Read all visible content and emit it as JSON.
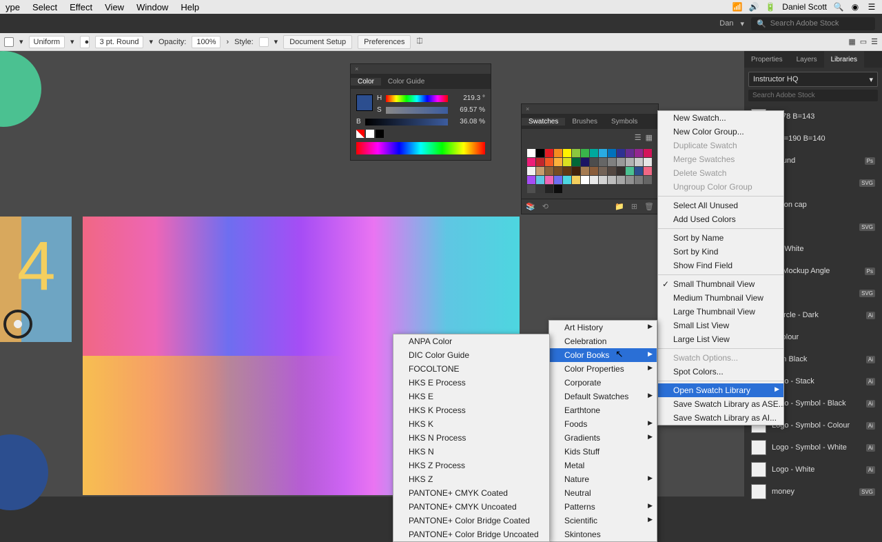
{
  "menubar": {
    "items": [
      "ype",
      "Select",
      "Effect",
      "View",
      "Window",
      "Help"
    ],
    "user": "Daniel Scott"
  },
  "appbar": {
    "user": "Dan",
    "stock_placeholder": "Search Adobe Stock"
  },
  "ctrlbar": {
    "stroke": "Uniform",
    "weight": "3 pt. Round",
    "opacity_label": "Opacity:",
    "opacity": "100%",
    "style_label": "Style:",
    "docsetup": "Document Setup",
    "prefs": "Preferences"
  },
  "colorpanel": {
    "tabs": [
      "Color",
      "Color Guide"
    ],
    "h": {
      "label": "H",
      "val": "219.3",
      "unit": "°"
    },
    "s": {
      "label": "S",
      "val": "69.57",
      "unit": "%"
    },
    "b": {
      "label": "B",
      "val": "36.08",
      "unit": "%"
    }
  },
  "swatchpanel": {
    "tabs": [
      "Swatches",
      "Brushes",
      "Symbols"
    ]
  },
  "libraries": {
    "tabs": [
      "Properties",
      "Layers",
      "Libraries"
    ],
    "dropdown": "Instructor HQ",
    "search": "Search Adobe Stock",
    "items": [
      {
        "label": "G=78 B=143",
        "tag": ""
      },
      {
        "label": "3 G=190 B=140",
        "tag": ""
      },
      {
        "label": "ground",
        "tag": "Ps"
      },
      {
        "label": "",
        "tag": "SVG"
      },
      {
        "label": "uation cap",
        "tag": ""
      },
      {
        "label": "",
        "tag": "SVG"
      },
      {
        "label": "e 6 White",
        "tag": ""
      },
      {
        "label": "e6 Mockup Angle",
        "tag": "Ps"
      },
      {
        "label": "",
        "tag": "SVG"
      },
      {
        "label": "- Circle - Dark",
        "tag": "Ai"
      },
      {
        "label": " - Colour",
        "tag": ""
      },
      {
        "label": " - On Black",
        "tag": "Ai"
      },
      {
        "label": "Logo - Stack",
        "tag": "Ai"
      },
      {
        "label": "Logo - Symbol - Black",
        "tag": "Ai"
      },
      {
        "label": "Logo - Symbol - Colour",
        "tag": "Ai"
      },
      {
        "label": "Logo - Symbol - White",
        "tag": "Ai"
      },
      {
        "label": "Logo - White",
        "tag": "Ai"
      },
      {
        "label": "money",
        "tag": "SVG"
      }
    ]
  },
  "fly1": {
    "items": [
      {
        "t": "New Swatch..."
      },
      {
        "t": "New Color Group..."
      },
      {
        "t": "Duplicate Swatch",
        "d": true
      },
      {
        "t": "Merge Swatches",
        "d": true
      },
      {
        "t": "Delete Swatch",
        "d": true
      },
      {
        "t": "Ungroup Color Group",
        "d": true
      },
      {
        "sep": true
      },
      {
        "t": "Select All Unused"
      },
      {
        "t": "Add Used Colors"
      },
      {
        "sep": true
      },
      {
        "t": "Sort by Name"
      },
      {
        "t": "Sort by Kind"
      },
      {
        "t": "Show Find Field"
      },
      {
        "sep": true
      },
      {
        "t": "Small Thumbnail View",
        "chk": true
      },
      {
        "t": "Medium Thumbnail View"
      },
      {
        "t": "Large Thumbnail View"
      },
      {
        "t": "Small List View"
      },
      {
        "t": "Large List View"
      },
      {
        "sep": true
      },
      {
        "t": "Swatch Options...",
        "d": true
      },
      {
        "t": "Spot Colors..."
      },
      {
        "sep": true
      },
      {
        "t": "Open Swatch Library",
        "sel": true,
        "ar": true
      },
      {
        "t": "Save Swatch Library as ASE..."
      },
      {
        "t": "Save Swatch Library as AI..."
      }
    ]
  },
  "fly2": {
    "items": [
      {
        "t": "Art History",
        "ar": true
      },
      {
        "t": "Celebration"
      },
      {
        "t": "Color Books",
        "sel": true,
        "ar": true
      },
      {
        "t": "Color Properties",
        "ar": true
      },
      {
        "t": "Corporate"
      },
      {
        "t": "Default Swatches",
        "ar": true
      },
      {
        "t": "Earthtone"
      },
      {
        "t": "Foods",
        "ar": true
      },
      {
        "t": "Gradients",
        "ar": true
      },
      {
        "t": "Kids Stuff"
      },
      {
        "t": "Metal"
      },
      {
        "t": "Nature",
        "ar": true
      },
      {
        "t": "Neutral"
      },
      {
        "t": "Patterns",
        "ar": true
      },
      {
        "t": "Scientific",
        "ar": true
      },
      {
        "t": "Skintones"
      }
    ]
  },
  "fly3": {
    "items": [
      {
        "t": "ANPA Color"
      },
      {
        "t": "DIC Color Guide"
      },
      {
        "t": "FOCOLTONE"
      },
      {
        "t": "HKS E Process"
      },
      {
        "t": "HKS E"
      },
      {
        "t": "HKS K Process"
      },
      {
        "t": "HKS K"
      },
      {
        "t": "HKS N Process"
      },
      {
        "t": "HKS N"
      },
      {
        "t": "HKS Z Process"
      },
      {
        "t": "HKS Z"
      },
      {
        "t": "PANTONE+ CMYK Coated"
      },
      {
        "t": "PANTONE+ CMYK Uncoated"
      },
      {
        "t": "PANTONE+ Color Bridge Coated"
      },
      {
        "t": "PANTONE+ Color Bridge Uncoated"
      }
    ]
  },
  "swatch_colors": [
    "#fff",
    "#000",
    "#e51b24",
    "#f68b1f",
    "#fff200",
    "#8cc63f",
    "#39b54a",
    "#00a99d",
    "#29abe2",
    "#0071bc",
    "#2e3192",
    "#662d91",
    "#93278f",
    "#d4145a",
    "#ed1e79",
    "#c1272d",
    "#f15a24",
    "#fbb03b",
    "#d9e021",
    "#006837",
    "#1b1464",
    "#4d4d4d",
    "#666",
    "#808080",
    "#999",
    "#b3b3b3",
    "#ccc",
    "#e6e6e6",
    "#f2f2f2",
    "#c69c6d",
    "#8c6239",
    "#754c24",
    "#603813",
    "#42210b",
    "#a67c52",
    "#8a5d3b",
    "#736357",
    "#534741",
    "#362f2d",
    "#4bc191",
    "#2c4e8f",
    "#f06784",
    "#a64df5",
    "#5fc6e3",
    "#ee66b6",
    "#6e6ef0",
    "#4dd6e0",
    "#f4cf5e"
  ]
}
